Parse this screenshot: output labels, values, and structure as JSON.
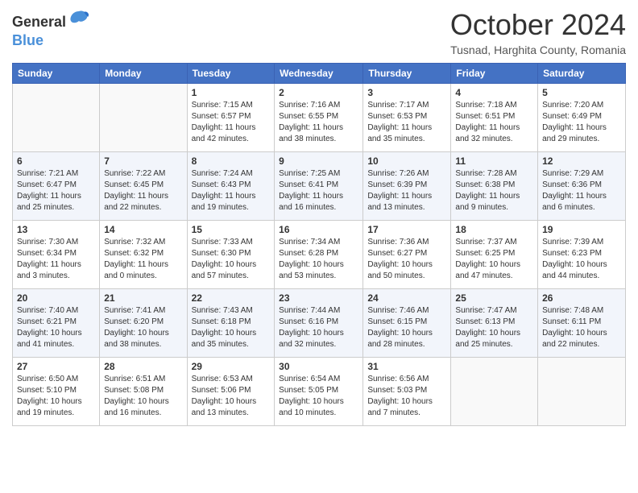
{
  "header": {
    "logo_general": "General",
    "logo_blue": "Blue",
    "title": "October 2024",
    "location": "Tusnad, Harghita County, Romania"
  },
  "weekdays": [
    "Sunday",
    "Monday",
    "Tuesday",
    "Wednesday",
    "Thursday",
    "Friday",
    "Saturday"
  ],
  "weeks": [
    [
      {
        "day": "",
        "info": ""
      },
      {
        "day": "",
        "info": ""
      },
      {
        "day": "1",
        "info": "Sunrise: 7:15 AM\nSunset: 6:57 PM\nDaylight: 11 hours and 42 minutes."
      },
      {
        "day": "2",
        "info": "Sunrise: 7:16 AM\nSunset: 6:55 PM\nDaylight: 11 hours and 38 minutes."
      },
      {
        "day": "3",
        "info": "Sunrise: 7:17 AM\nSunset: 6:53 PM\nDaylight: 11 hours and 35 minutes."
      },
      {
        "day": "4",
        "info": "Sunrise: 7:18 AM\nSunset: 6:51 PM\nDaylight: 11 hours and 32 minutes."
      },
      {
        "day": "5",
        "info": "Sunrise: 7:20 AM\nSunset: 6:49 PM\nDaylight: 11 hours and 29 minutes."
      }
    ],
    [
      {
        "day": "6",
        "info": "Sunrise: 7:21 AM\nSunset: 6:47 PM\nDaylight: 11 hours and 25 minutes."
      },
      {
        "day": "7",
        "info": "Sunrise: 7:22 AM\nSunset: 6:45 PM\nDaylight: 11 hours and 22 minutes."
      },
      {
        "day": "8",
        "info": "Sunrise: 7:24 AM\nSunset: 6:43 PM\nDaylight: 11 hours and 19 minutes."
      },
      {
        "day": "9",
        "info": "Sunrise: 7:25 AM\nSunset: 6:41 PM\nDaylight: 11 hours and 16 minutes."
      },
      {
        "day": "10",
        "info": "Sunrise: 7:26 AM\nSunset: 6:39 PM\nDaylight: 11 hours and 13 minutes."
      },
      {
        "day": "11",
        "info": "Sunrise: 7:28 AM\nSunset: 6:38 PM\nDaylight: 11 hours and 9 minutes."
      },
      {
        "day": "12",
        "info": "Sunrise: 7:29 AM\nSunset: 6:36 PM\nDaylight: 11 hours and 6 minutes."
      }
    ],
    [
      {
        "day": "13",
        "info": "Sunrise: 7:30 AM\nSunset: 6:34 PM\nDaylight: 11 hours and 3 minutes."
      },
      {
        "day": "14",
        "info": "Sunrise: 7:32 AM\nSunset: 6:32 PM\nDaylight: 11 hours and 0 minutes."
      },
      {
        "day": "15",
        "info": "Sunrise: 7:33 AM\nSunset: 6:30 PM\nDaylight: 10 hours and 57 minutes."
      },
      {
        "day": "16",
        "info": "Sunrise: 7:34 AM\nSunset: 6:28 PM\nDaylight: 10 hours and 53 minutes."
      },
      {
        "day": "17",
        "info": "Sunrise: 7:36 AM\nSunset: 6:27 PM\nDaylight: 10 hours and 50 minutes."
      },
      {
        "day": "18",
        "info": "Sunrise: 7:37 AM\nSunset: 6:25 PM\nDaylight: 10 hours and 47 minutes."
      },
      {
        "day": "19",
        "info": "Sunrise: 7:39 AM\nSunset: 6:23 PM\nDaylight: 10 hours and 44 minutes."
      }
    ],
    [
      {
        "day": "20",
        "info": "Sunrise: 7:40 AM\nSunset: 6:21 PM\nDaylight: 10 hours and 41 minutes."
      },
      {
        "day": "21",
        "info": "Sunrise: 7:41 AM\nSunset: 6:20 PM\nDaylight: 10 hours and 38 minutes."
      },
      {
        "day": "22",
        "info": "Sunrise: 7:43 AM\nSunset: 6:18 PM\nDaylight: 10 hours and 35 minutes."
      },
      {
        "day": "23",
        "info": "Sunrise: 7:44 AM\nSunset: 6:16 PM\nDaylight: 10 hours and 32 minutes."
      },
      {
        "day": "24",
        "info": "Sunrise: 7:46 AM\nSunset: 6:15 PM\nDaylight: 10 hours and 28 minutes."
      },
      {
        "day": "25",
        "info": "Sunrise: 7:47 AM\nSunset: 6:13 PM\nDaylight: 10 hours and 25 minutes."
      },
      {
        "day": "26",
        "info": "Sunrise: 7:48 AM\nSunset: 6:11 PM\nDaylight: 10 hours and 22 minutes."
      }
    ],
    [
      {
        "day": "27",
        "info": "Sunrise: 6:50 AM\nSunset: 5:10 PM\nDaylight: 10 hours and 19 minutes."
      },
      {
        "day": "28",
        "info": "Sunrise: 6:51 AM\nSunset: 5:08 PM\nDaylight: 10 hours and 16 minutes."
      },
      {
        "day": "29",
        "info": "Sunrise: 6:53 AM\nSunset: 5:06 PM\nDaylight: 10 hours and 13 minutes."
      },
      {
        "day": "30",
        "info": "Sunrise: 6:54 AM\nSunset: 5:05 PM\nDaylight: 10 hours and 10 minutes."
      },
      {
        "day": "31",
        "info": "Sunrise: 6:56 AM\nSunset: 5:03 PM\nDaylight: 10 hours and 7 minutes."
      },
      {
        "day": "",
        "info": ""
      },
      {
        "day": "",
        "info": ""
      }
    ]
  ]
}
